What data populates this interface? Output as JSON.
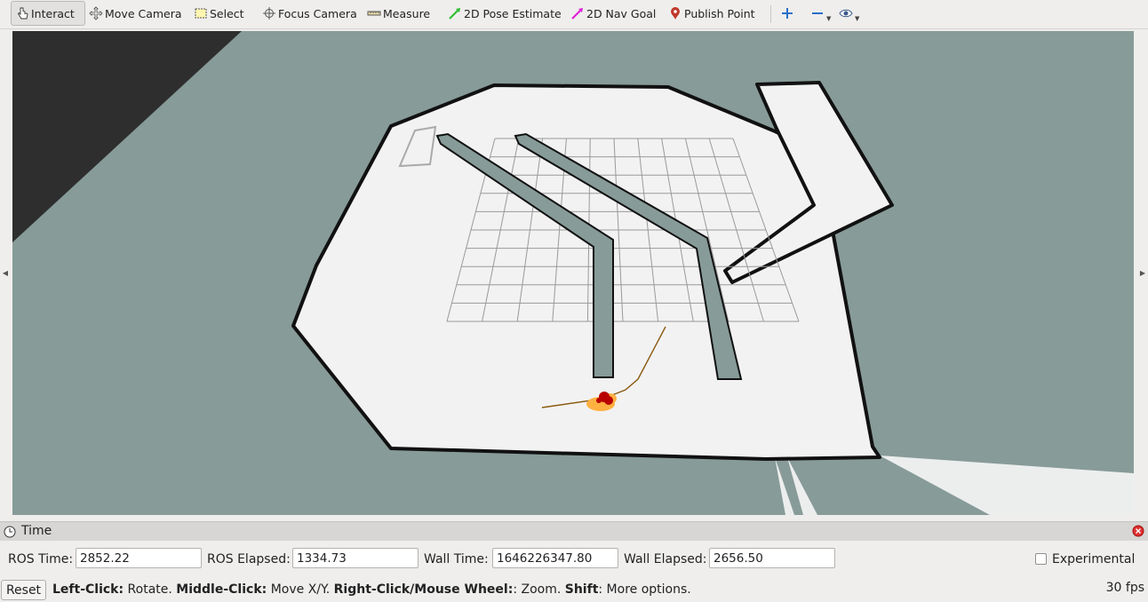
{
  "toolbar": {
    "tools": [
      {
        "label": "Interact",
        "icon": "hand-pointer-icon",
        "active": true
      },
      {
        "label": "Move Camera",
        "icon": "move-camera-icon"
      },
      {
        "label": "Select",
        "icon": "select-rect-icon"
      },
      {
        "label": "Focus Camera",
        "icon": "focus-crosshair-icon"
      },
      {
        "label": "Measure",
        "icon": "ruler-icon"
      },
      {
        "label": "2D Pose Estimate",
        "icon": "green-arrow-icon",
        "color": "#2fbe2f"
      },
      {
        "label": "2D Nav Goal",
        "icon": "magenta-arrow-icon",
        "color": "#e020d8"
      },
      {
        "label": "Publish Point",
        "icon": "map-pin-icon",
        "color": "#c0392b"
      }
    ],
    "right_icons": [
      "plus-icon",
      "minus-icon",
      "eye-icon"
    ]
  },
  "time_panel": {
    "title": "Time",
    "ros_time_label": "ROS Time:",
    "ros_time": "2852.22",
    "ros_elapsed_label": "ROS Elapsed:",
    "ros_elapsed": "1334.73",
    "wall_time_label": "Wall Time:",
    "wall_time": "1646226347.80",
    "wall_elapsed_label": "Wall Elapsed:",
    "wall_elapsed": "2656.50",
    "experimental_label": "Experimental",
    "experimental_checked": false
  },
  "status_bar": {
    "reset_label": "Reset",
    "help": [
      {
        "bold": "Left-Click:",
        "text": " Rotate. "
      },
      {
        "bold": "Middle-Click:",
        "text": " Move X/Y. "
      },
      {
        "bold": "Right-Click/Mouse Wheel:",
        "text": ": Zoom. "
      },
      {
        "bold": "Shift",
        "text": ": More options."
      }
    ],
    "fps": "30 fps"
  },
  "colors": {
    "viewport_bg": "#879b98",
    "map_free": "#f2f2f2",
    "map_wall": "#111111",
    "path": "#8a5a10",
    "particles": "#ffb040",
    "robot": "#b80000"
  }
}
